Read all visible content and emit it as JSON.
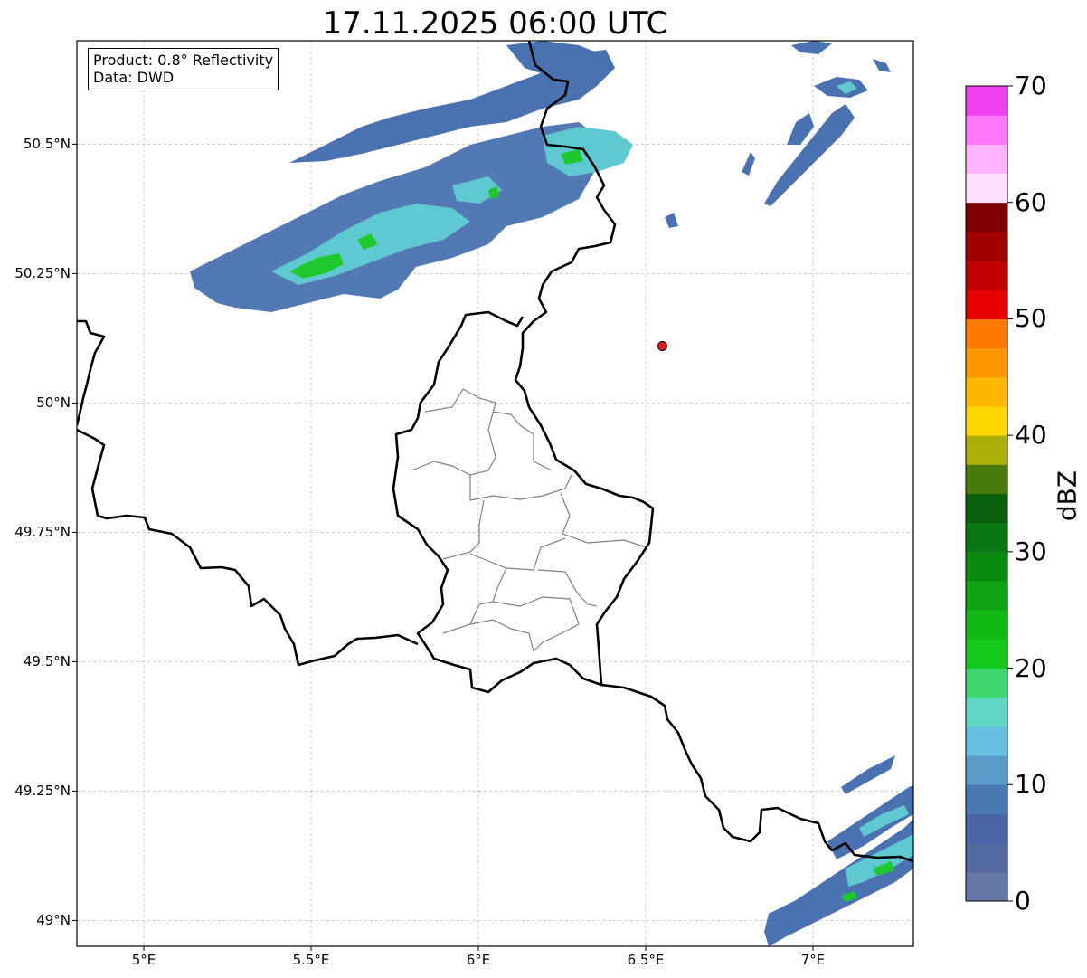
{
  "map": {
    "title": "17.11.2025 06:00 UTC",
    "info_box": {
      "product": "Product: 0.8° Reflectivity",
      "source": "Data: DWD"
    },
    "lon_ticks": [
      {
        "value": 5.0,
        "label": "5°E"
      },
      {
        "value": 5.5,
        "label": "5.5°E"
      },
      {
        "value": 6.0,
        "label": "6°E"
      },
      {
        "value": 6.5,
        "label": "6.5°E"
      },
      {
        "value": 7.0,
        "label": "7°E"
      }
    ],
    "lat_ticks": [
      {
        "value": 50.5,
        "label": "50.5°N"
      },
      {
        "value": 50.25,
        "label": "50.25°N"
      },
      {
        "value": 50.0,
        "label": "50°N"
      },
      {
        "value": 49.75,
        "label": "49.75°N"
      },
      {
        "value": 49.5,
        "label": "49.5°N"
      },
      {
        "value": 49.25,
        "label": "49.25°N"
      },
      {
        "value": 49.0,
        "label": "49°N"
      }
    ],
    "extent": {
      "lon_min": 4.8,
      "lon_max": 7.3,
      "lat_min": 48.95,
      "lat_max": 50.7
    },
    "marker": {
      "lon": 6.55,
      "lat": 50.11,
      "color": "#e8151b"
    },
    "colorbar": {
      "label": "dBZ",
      "min": 0,
      "max": 70,
      "ticks": [
        "0",
        "10",
        "20",
        "30",
        "40",
        "50",
        "60",
        "70"
      ],
      "colors": [
        "#6478a8",
        "#5468a0",
        "#4a64a6",
        "#4a7ab4",
        "#5a9cc8",
        "#68c0e0",
        "#60d6c4",
        "#40d670",
        "#14c81c",
        "#12b814",
        "#12a214",
        "#0c8a10",
        "#0a7812",
        "#0a5e0c",
        "#4a7a0c",
        "#acae0a",
        "#fed800",
        "#feb800",
        "#fe9800",
        "#fe7a00",
        "#e60000",
        "#c00000",
        "#a00000",
        "#7e0000",
        "#ffe0ff",
        "#ffb4ff",
        "#ff78fa",
        "#ee40f0"
      ]
    },
    "colors": {
      "border": "#000000",
      "admin": "#808080",
      "grid": "#bbbbbb",
      "echo_low": "#4a72b0",
      "echo_mid": "#60c8d0",
      "echo_high": "#20c830"
    }
  }
}
